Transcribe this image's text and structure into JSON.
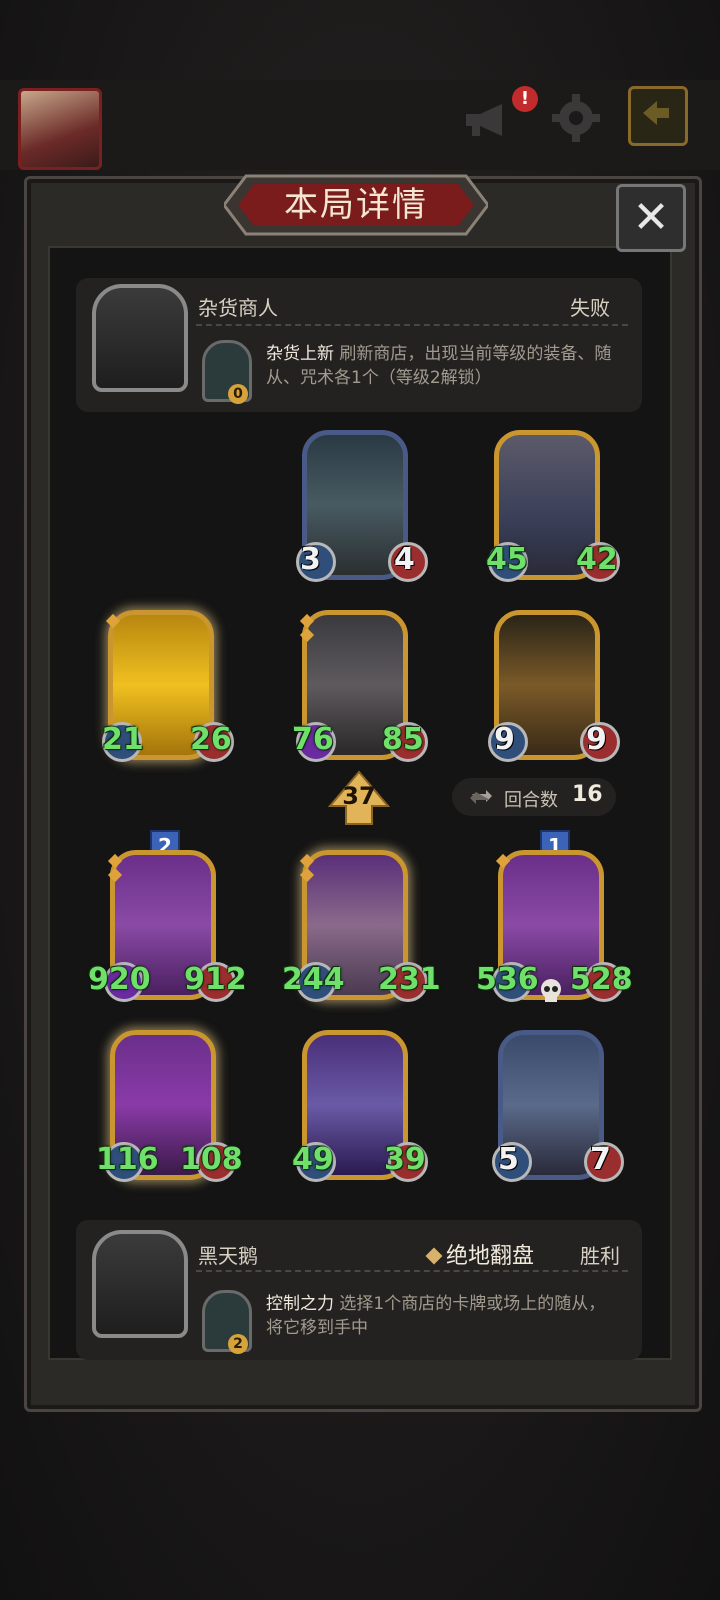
{
  "dialog": {
    "title": "本局详情"
  },
  "top_hero": {
    "name": "杂货商人",
    "result": "失败",
    "skill": {
      "name": "杂货上新",
      "description": "刷新商店，出现当前等级的装备、随从、咒术各1个（等级2解锁）",
      "cost": "0"
    }
  },
  "bottom_hero": {
    "name": "黑天鹅",
    "result": "胜利",
    "final_move": "绝地翻盘",
    "skill": {
      "name": "控制之力",
      "description": "选择1个商店的卡牌或场上的随从，将它移到手中",
      "cost": "2"
    }
  },
  "level_badge": "37",
  "turns": {
    "label": "回合数",
    "value": "16"
  },
  "top_board": [
    {
      "atk": "3",
      "hp": "4"
    },
    {
      "atk": "45",
      "hp": "42"
    },
    {
      "atk": "21",
      "hp": "26"
    },
    {
      "atk": "76",
      "hp": "85"
    },
    {
      "atk": "9",
      "hp": "9"
    }
  ],
  "bottom_board": [
    {
      "atk": "920",
      "hp": "912",
      "star": "2"
    },
    {
      "atk": "244",
      "hp": "231"
    },
    {
      "atk": "536",
      "hp": "528",
      "star": "1"
    },
    {
      "atk": "116",
      "hp": "108"
    },
    {
      "atk": "49",
      "hp": "39"
    },
    {
      "atk": "5",
      "hp": "7"
    }
  ],
  "icons": {
    "alert": "!",
    "close": "✕"
  }
}
